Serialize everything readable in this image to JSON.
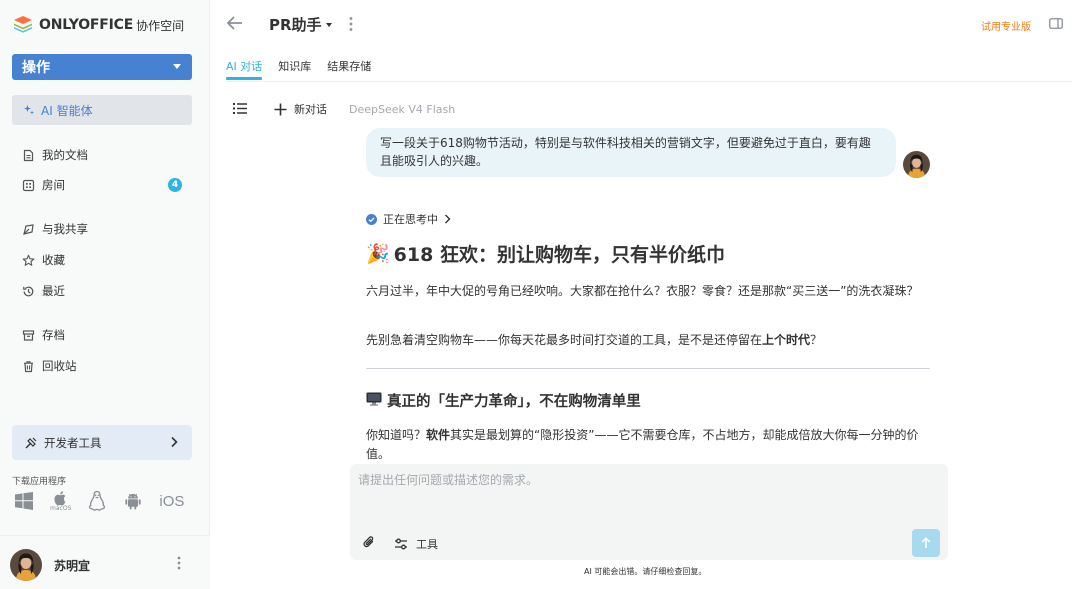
{
  "brand": {
    "name": "ONLYOFFICE",
    "subtitle": "协作空间"
  },
  "sidebar": {
    "action_label": "操作",
    "active_item": "AI 智能体",
    "items": [
      {
        "label": "我的文档",
        "icon": "document-icon"
      },
      {
        "label": "房间",
        "icon": "rooms-icon",
        "badge": "4"
      },
      {
        "label": "与我共享",
        "icon": "shared-icon"
      },
      {
        "label": "收藏",
        "icon": "star-icon"
      },
      {
        "label": "最近",
        "icon": "recent-icon"
      },
      {
        "label": "存档",
        "icon": "archive-icon"
      },
      {
        "label": "回收站",
        "icon": "trash-icon"
      }
    ],
    "dev_tools_label": "开发者工具",
    "download_label": "下载应用程序",
    "os_labels": {
      "macos": "macOS",
      "ios": "iOS"
    }
  },
  "user": {
    "name": "苏明宜"
  },
  "header": {
    "title": "PR助手",
    "try_pro": "试用专业版"
  },
  "tabs": [
    {
      "label": "AI 对话",
      "active": true
    },
    {
      "label": "知识库",
      "active": false
    },
    {
      "label": "结果存储",
      "active": false
    }
  ],
  "toolbar": {
    "new_chat": "新对话",
    "model": "DeepSeek V4 Flash"
  },
  "chat": {
    "user_message": "写一段关于618购物节活动，特别是与软件科技相关的营销文字，但要避免过于直白，要有趣且能吸引人的兴趣。",
    "thinking": "正在思考中",
    "title_emoji": "🎉",
    "title": "618 狂欢：别让购物车，只有半价纸巾",
    "para1": "六月过半，年中大促的号角已经吹响。大家都在抢什么？衣服？零食？还是那款“买三送一”的洗衣凝珠？",
    "para2_prefix": "先别急着清空购物车——你每天花最多时间打交道的工具，是不是还停留在",
    "para2_bold": "上个时代",
    "para2_suffix": "？",
    "heading2_emoji": "🖥",
    "heading2": "真正的「生产力革命」，不在购物清单里",
    "para3_prefix": "你知道吗？",
    "para3_bold": "软件",
    "para3_suffix": "其实是最划算的“隐形投资”——它不需要仓库，不占地方，却能成倍放大你每一分钟的价值。"
  },
  "composer": {
    "placeholder": "请提出任何问题或描述您的需求。",
    "tools_label": "工具",
    "disclaimer": "AI 可能会出错。请仔细检查回复。"
  },
  "colors": {
    "accent": "#2db4e2",
    "primary": "#4781d1",
    "pro": "#f07c12"
  }
}
